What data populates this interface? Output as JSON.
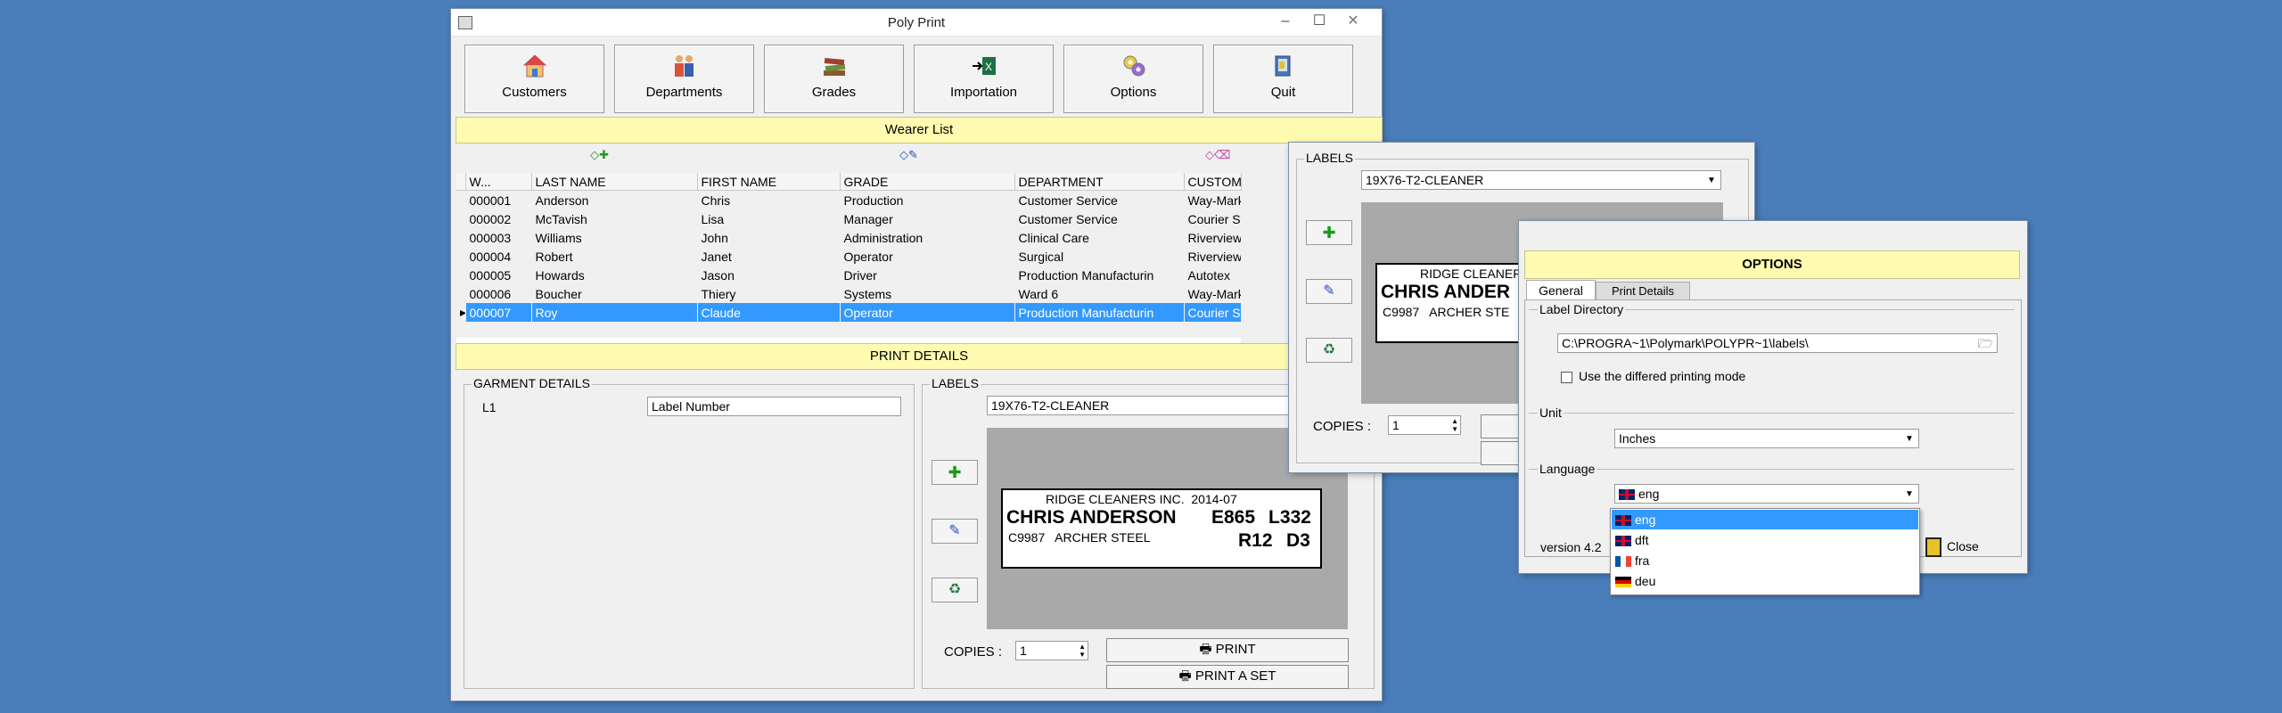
{
  "main_window": {
    "title": "Poly Print",
    "toolbar": [
      {
        "label": "Customers",
        "icon": "house-icon"
      },
      {
        "label": "Departments",
        "icon": "people-icon"
      },
      {
        "label": "Grades",
        "icon": "books-icon"
      },
      {
        "label": "Importation",
        "icon": "excel-import-icon"
      },
      {
        "label": "Options",
        "icon": "options-icon"
      },
      {
        "label": "Quit",
        "icon": "exit-icon"
      }
    ],
    "wearer_list_title": "Wearer List",
    "columns": [
      "W...",
      "LAST NAME",
      "FIRST NAME",
      "GRADE",
      "DEPARTMENT",
      "CUSTOMER"
    ],
    "rows": [
      [
        "000001",
        "Anderson",
        "Chris",
        "Production",
        "Customer Service",
        "Way-Mark Paint"
      ],
      [
        "000002",
        "McTavish",
        "Lisa",
        "Manager",
        "Customer Service",
        "Courier Systems"
      ],
      [
        "000003",
        "Williams",
        "John",
        "Administration",
        "Clinical Care",
        "Riverview Nursi"
      ],
      [
        "000004",
        "Robert",
        "Janet",
        "Operator",
        "Surgical",
        "Riverview Nursi"
      ],
      [
        "000005",
        "Howards",
        "Jason",
        "Driver",
        "Production Manufacturin",
        "Autotex"
      ],
      [
        "000006",
        "Boucher",
        "Thiery",
        "Systems",
        "Ward 6",
        "Way-Mark Paint"
      ],
      [
        "000007",
        "Roy",
        "Claude",
        "Operator",
        "Production Manufacturin",
        "Courier Systems"
      ]
    ],
    "selected_row_index": 6,
    "print_details_title": "PRINT DETAILS",
    "garment_details": {
      "title": "GARMENT DETAILS",
      "field_code": "L1",
      "field_value": "Label Number"
    },
    "labels": {
      "title": "LABELS",
      "selected": "19X76-T2-CLEANER",
      "copies_label": "COPIES :",
      "copies_value": "1",
      "print_label": "PRINT",
      "print_set_label": "PRINT A SET"
    },
    "label_preview": {
      "line1": "RIDGE CLEANERS INC.  2014-07",
      "name": "CHRIS ANDERSON",
      "code1": "E865",
      "code2": "L332",
      "line3": "C9987   ARCHER STEEL",
      "code3": "R12",
      "code4": "D3"
    }
  },
  "second_window": {
    "labels_title": "LABELS",
    "selected": "19X76-T2-CLEANER",
    "preview_line1": "RIDGE CLEANER",
    "preview_name": "CHRIS ANDER",
    "preview_line3": "C9987   ARCHER STE",
    "copies_label": "COPIES :",
    "copies_value": "1"
  },
  "options_window": {
    "title": "OPTIONS",
    "tabs": [
      "General",
      "Print Details"
    ],
    "label_directory_title": "Label Directory",
    "label_directory_value": "C:\\PROGRA~1\\Polymark\\POLYPR~1\\labels\\",
    "differed_printing_label": "Use the differed printing mode",
    "unit_title": "Unit",
    "unit_value": "Inches",
    "language_title": "Language",
    "language_value": "eng",
    "language_options": [
      "eng",
      "dft",
      "fra",
      "deu"
    ],
    "version_text": "version 4.2",
    "close_label": "Close"
  },
  "colors": {
    "desktop": "#4a7ebb",
    "header_yellow": "#fffbb0",
    "selection": "#3399ff"
  }
}
